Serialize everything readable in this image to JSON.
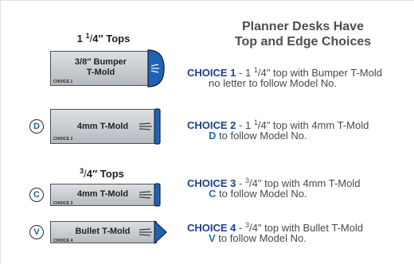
{
  "heading": {
    "line1": "Planner Desks Have",
    "line2": "Top and Edge Choices"
  },
  "groups": [
    {
      "whole": "1 ",
      "num": "1",
      "den": "4",
      "unit": "″ Tops"
    },
    {
      "whole": "",
      "num": "3",
      "den": "4",
      "unit": "″ Tops"
    }
  ],
  "profiles": [
    {
      "label_line1": "3/8″ Bumper",
      "label_line2": "T-Mold",
      "tag": "CHOICE 1",
      "letter": ""
    },
    {
      "label_line1": "4mm T-Mold",
      "label_line2": "",
      "tag": "CHOICE 2",
      "letter": "D"
    },
    {
      "label_line1": "4mm T-Mold",
      "label_line2": "",
      "tag": "CHOICE 3",
      "letter": "C"
    },
    {
      "label_line1": "Bullet T-Mold",
      "label_line2": "",
      "tag": "CHOICE 4",
      "letter": "V"
    }
  ],
  "choices": [
    {
      "name": "CHOICE 1",
      "sep": " - ",
      "whole": "1 ",
      "num": "1",
      "den": "4",
      "rest": "\" top with Bumper T-Mold",
      "line2_letter": "",
      "line2_text": "no letter to follow Model No."
    },
    {
      "name": "CHOICE 2",
      "sep": " - ",
      "whole": "1 ",
      "num": "1",
      "den": "4",
      "rest": "\" top with 4mm T-Mold",
      "line2_letter": "D",
      "line2_text": " to follow Model No."
    },
    {
      "name": "CHOICE 3",
      "sep": " - ",
      "whole": "",
      "num": "3",
      "den": "4",
      "rest": "\" top with 4mm T-Mold",
      "line2_letter": "C",
      "line2_text": " to follow Model No."
    },
    {
      "name": "CHOICE 4",
      "sep": " - ",
      "whole": "",
      "num": "3",
      "den": "4",
      "rest": "\" top with Bullet T-Mold",
      "line2_letter": "V",
      "line2_text": " to follow Model No."
    }
  ],
  "colors": {
    "edge_blue": "#1f63b4",
    "profile_grey": "#c8ccd0",
    "choice_name": "#1d3f8f",
    "letter_blue": "#1f6fc4"
  }
}
